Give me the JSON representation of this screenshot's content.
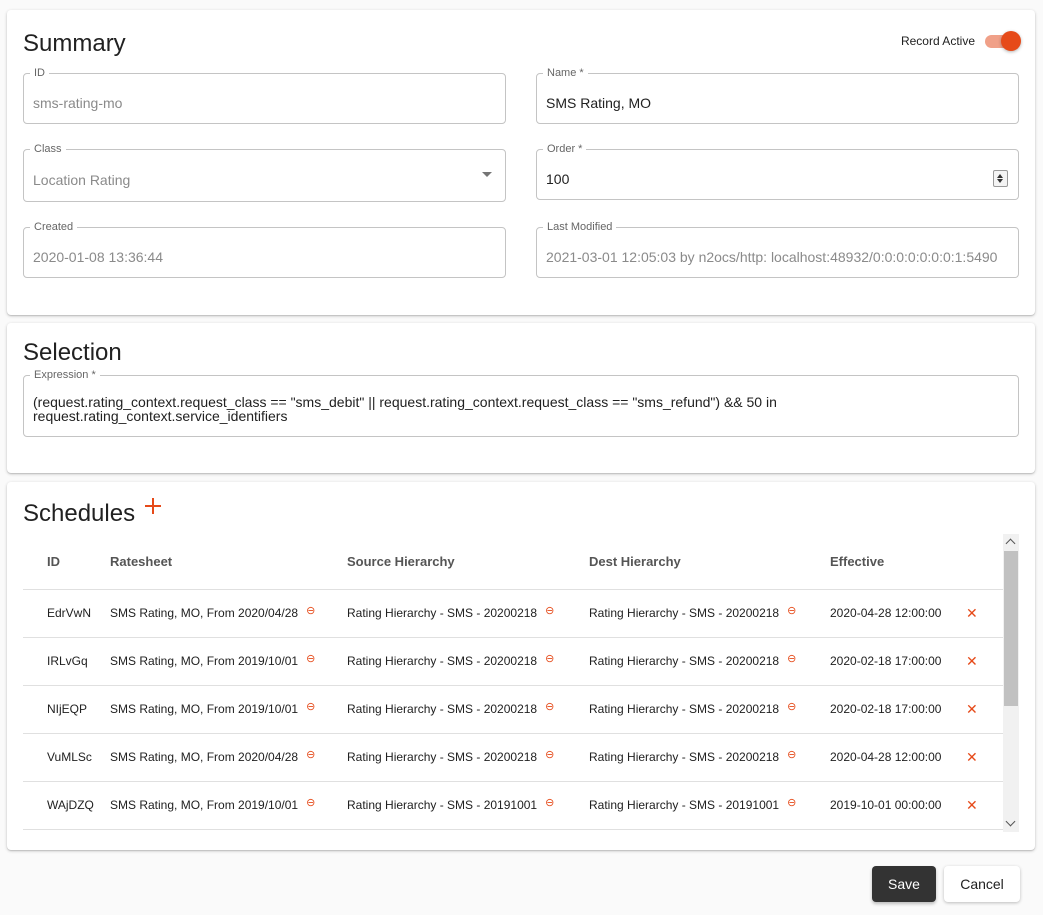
{
  "summary": {
    "title": "Summary",
    "record_active_label": "Record Active",
    "record_active": true,
    "fields": {
      "id": {
        "label": "ID",
        "value": "sms-rating-mo"
      },
      "name": {
        "label": "Name *",
        "value": "SMS Rating, MO"
      },
      "class": {
        "label": "Class",
        "value": "Location Rating"
      },
      "order": {
        "label": "Order *",
        "value": "100"
      },
      "created": {
        "label": "Created",
        "value": "2020-01-08 13:36:44"
      },
      "last_modified": {
        "label": "Last Modified",
        "value": "2021-03-01 12:05:03 by n2ocs/http: localhost:48932/0:0:0:0:0:0:0:1:5490"
      }
    }
  },
  "selection": {
    "title": "Selection",
    "expression_label": "Expression *",
    "expression_value": "(request.rating_context.request_class == \"sms_debit\" || request.rating_context.request_class == \"sms_refund\") && 50 in request.rating_context.service_identifiers"
  },
  "schedules": {
    "title": "Schedules",
    "columns": [
      "ID",
      "Ratesheet",
      "Source Hierarchy",
      "Dest Hierarchy",
      "Effective"
    ],
    "rows": [
      {
        "id": "EdrVwN",
        "ratesheet": "SMS Rating, MO, From 2020/04/28",
        "source": "Rating Hierarchy - SMS - 20200218",
        "dest": "Rating Hierarchy - SMS - 20200218",
        "effective": "2020-04-28 12:00:00"
      },
      {
        "id": "IRLvGq",
        "ratesheet": "SMS Rating, MO, From 2019/10/01",
        "source": "Rating Hierarchy - SMS - 20200218",
        "dest": "Rating Hierarchy - SMS - 20200218",
        "effective": "2020-02-18 17:00:00"
      },
      {
        "id": "NIjEQP",
        "ratesheet": "SMS Rating, MO, From 2019/10/01",
        "source": "Rating Hierarchy - SMS - 20200218",
        "dest": "Rating Hierarchy - SMS - 20200218",
        "effective": "2020-02-18 17:00:00"
      },
      {
        "id": "VuMLSc",
        "ratesheet": "SMS Rating, MO, From 2020/04/28",
        "source": "Rating Hierarchy - SMS - 20200218",
        "dest": "Rating Hierarchy - SMS - 20200218",
        "effective": "2020-04-28 12:00:00"
      },
      {
        "id": "WAjDZQ",
        "ratesheet": "SMS Rating, MO, From 2019/10/01",
        "source": "Rating Hierarchy - SMS - 20191001",
        "dest": "Rating Hierarchy - SMS - 20191001",
        "effective": "2019-10-01 00:00:00"
      }
    ],
    "link_icon": "link-icon",
    "delete_icon": "close-icon"
  },
  "actions": {
    "save_label": "Save",
    "cancel_label": "Cancel"
  },
  "colors": {
    "accent": "#e64a19",
    "save_button_bg": "#333333"
  }
}
